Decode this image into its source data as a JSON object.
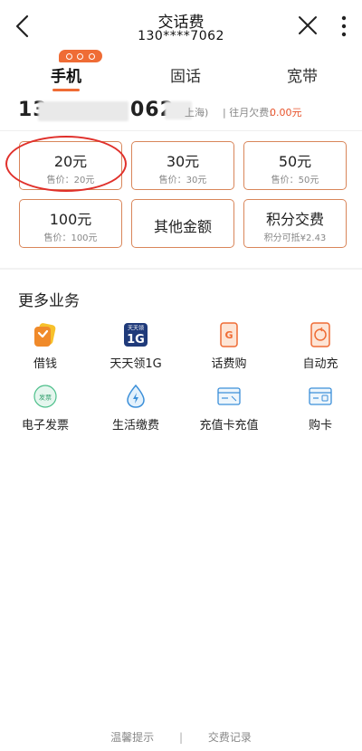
{
  "header": {
    "title": "交话费",
    "phone_masked": "130****7062"
  },
  "tabs": [
    {
      "label": "手机",
      "active": true
    },
    {
      "label": "固话",
      "active": false
    },
    {
      "label": "宽带",
      "active": false
    }
  ],
  "account": {
    "phone_start": "13",
    "phone_end": "062",
    "region": "上海)",
    "arrears_label": "| 往月欠费:",
    "arrears_value": "0.00元"
  },
  "amounts": [
    {
      "amount": "20元",
      "price": "售价：20元",
      "circled": true
    },
    {
      "amount": "30元",
      "price": "售价：30元"
    },
    {
      "amount": "50元",
      "price": "售价：50元"
    },
    {
      "amount": "100元",
      "price": "售价：100元"
    },
    {
      "amount": "其他金额",
      "price": ""
    },
    {
      "amount": "积分交费",
      "price": "积分可抵¥2.43"
    }
  ],
  "more_services": {
    "title": "更多业务",
    "items": [
      {
        "label": "借钱",
        "icon": "loan-icon"
      },
      {
        "label": "天天领1G",
        "icon": "daily-1g-icon",
        "icon_text_top": "天天领",
        "icon_text_main": "1G"
      },
      {
        "label": "话费购",
        "icon": "phone-bill-shop-icon",
        "icon_text": "G"
      },
      {
        "label": "自动充",
        "icon": "auto-recharge-icon"
      },
      {
        "label": "电子发票",
        "icon": "e-invoice-icon",
        "icon_text": "发票"
      },
      {
        "label": "生活缴费",
        "icon": "utility-payment-icon"
      },
      {
        "label": "充值卡充值",
        "icon": "recharge-card-icon"
      },
      {
        "label": "购卡",
        "icon": "buy-card-icon"
      }
    ]
  },
  "footer": {
    "tips": "温馨提示",
    "separator": "|",
    "records": "交费记录"
  },
  "colors": {
    "accent": "#ef6c35",
    "card_border": "#d9865a",
    "circle_red": "#e0302b",
    "arrears": "#e8532b",
    "navy": "#1f3a7a"
  }
}
